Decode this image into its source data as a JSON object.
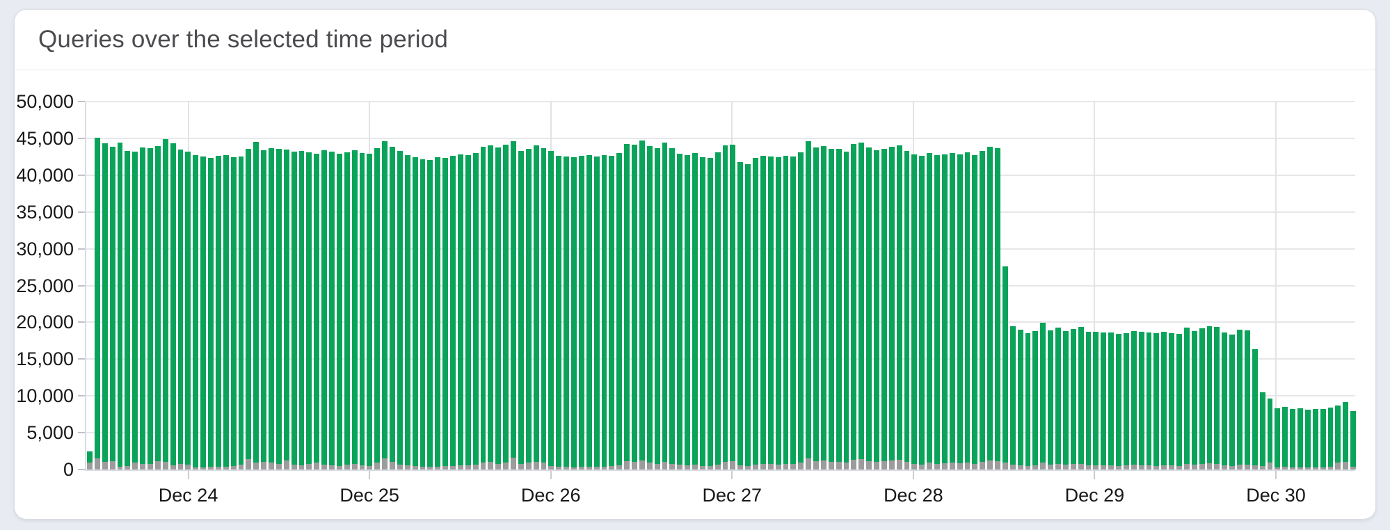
{
  "header": {
    "title": "Queries over the selected time period"
  },
  "chart_data": {
    "type": "bar",
    "stacked": true,
    "title": "Queries over the selected time period",
    "xlabel": "",
    "ylabel": "",
    "ylim": [
      0,
      50000
    ],
    "grid": true,
    "legend_position": "none",
    "y_tick_labels": [
      "0",
      "5,000",
      "10,000",
      "15,000",
      "20,000",
      "25,000",
      "30,000",
      "35,000",
      "40,000",
      "45,000",
      "50,000"
    ],
    "x_tick_labels": [
      "Dec 24",
      "Dec 25",
      "Dec 26",
      "Dec 27",
      "Dec 28",
      "Dec 29",
      "Dec 30"
    ],
    "bars_per_day": 24,
    "first_x_tick_bar_index": 13,
    "series": [
      {
        "name": "total-queries",
        "color": "#0aa35a",
        "values": [
          2500,
          45100,
          44300,
          43900,
          44400,
          43300,
          43200,
          43800,
          43700,
          44000,
          44900,
          44300,
          43500,
          43200,
          42700,
          42500,
          42300,
          42600,
          42700,
          42400,
          42500,
          43600,
          44500,
          43400,
          43700,
          43600,
          43500,
          43200,
          43300,
          43100,
          42900,
          43400,
          43200,
          42900,
          43100,
          43400,
          43000,
          42900,
          43700,
          44600,
          43900,
          43300,
          42700,
          42400,
          42200,
          42100,
          42400,
          42300,
          42600,
          42800,
          42700,
          43000,
          43900,
          44000,
          43800,
          44100,
          44600,
          43300,
          43600,
          44000,
          43700,
          43300,
          42600,
          42500,
          42400,
          42600,
          42700,
          42500,
          42700,
          42600,
          43000,
          44200,
          44100,
          44700,
          44000,
          43700,
          44400,
          43700,
          42900,
          42700,
          43000,
          42400,
          42300,
          43100,
          44000,
          44100,
          41800,
          41500,
          42300,
          42600,
          42500,
          42400,
          42600,
          42500,
          43100,
          44600,
          43800,
          44000,
          43600,
          43600,
          43200,
          44200,
          44400,
          43800,
          43400,
          43600,
          43900,
          44000,
          43300,
          42800,
          42600,
          43000,
          42700,
          42800,
          43000,
          42800,
          43100,
          42700,
          43300,
          43900,
          43700,
          27600,
          19500,
          19000,
          18500,
          18800,
          19900,
          18900,
          19300,
          18800,
          19100,
          19400,
          18700,
          18700,
          18600,
          18600,
          18400,
          18500,
          18800,
          18700,
          18600,
          18500,
          18700,
          18500,
          18400,
          19300,
          18800,
          19200,
          19500,
          19400,
          18600,
          18300,
          19000,
          18900,
          16400,
          10500,
          9600,
          8350,
          8500,
          8200,
          8300,
          8150,
          8250,
          8200,
          8400,
          8700,
          9150,
          7900
        ]
      },
      {
        "name": "bottom-gray-segment",
        "color": "#9c9c9c",
        "values": [
          900,
          1500,
          1000,
          1100,
          400,
          500,
          900,
          800,
          800,
          1100,
          1000,
          600,
          800,
          700,
          300,
          300,
          350,
          400,
          350,
          450,
          700,
          1400,
          900,
          1000,
          900,
          800,
          1200,
          700,
          600,
          800,
          900,
          700,
          600,
          500,
          700,
          800,
          600,
          500,
          900,
          1500,
          1000,
          700,
          600,
          500,
          400,
          350,
          400,
          450,
          500,
          600,
          550,
          700,
          900,
          1000,
          800,
          900,
          1600,
          800,
          900,
          1000,
          900,
          500,
          400,
          350,
          300,
          350,
          400,
          350,
          400,
          450,
          600,
          1100,
          1000,
          1200,
          900,
          800,
          1000,
          800,
          700,
          600,
          700,
          500,
          450,
          700,
          1000,
          1100,
          600,
          500,
          700,
          800,
          750,
          700,
          800,
          750,
          900,
          1500,
          1100,
          1200,
          1000,
          1000,
          900,
          1300,
          1400,
          1100,
          1000,
          1100,
          1200,
          1300,
          1000,
          800,
          700,
          900,
          800,
          850,
          900,
          850,
          950,
          800,
          1000,
          1200,
          1100,
          900,
          700,
          600,
          500,
          600,
          900,
          700,
          800,
          700,
          750,
          800,
          600,
          600,
          550,
          550,
          500,
          550,
          650,
          600,
          550,
          500,
          600,
          550,
          500,
          800,
          650,
          750,
          850,
          800,
          550,
          450,
          700,
          650,
          600,
          500,
          900,
          300,
          350,
          250,
          300,
          250,
          300,
          280,
          350,
          900,
          1000,
          400
        ]
      }
    ]
  }
}
